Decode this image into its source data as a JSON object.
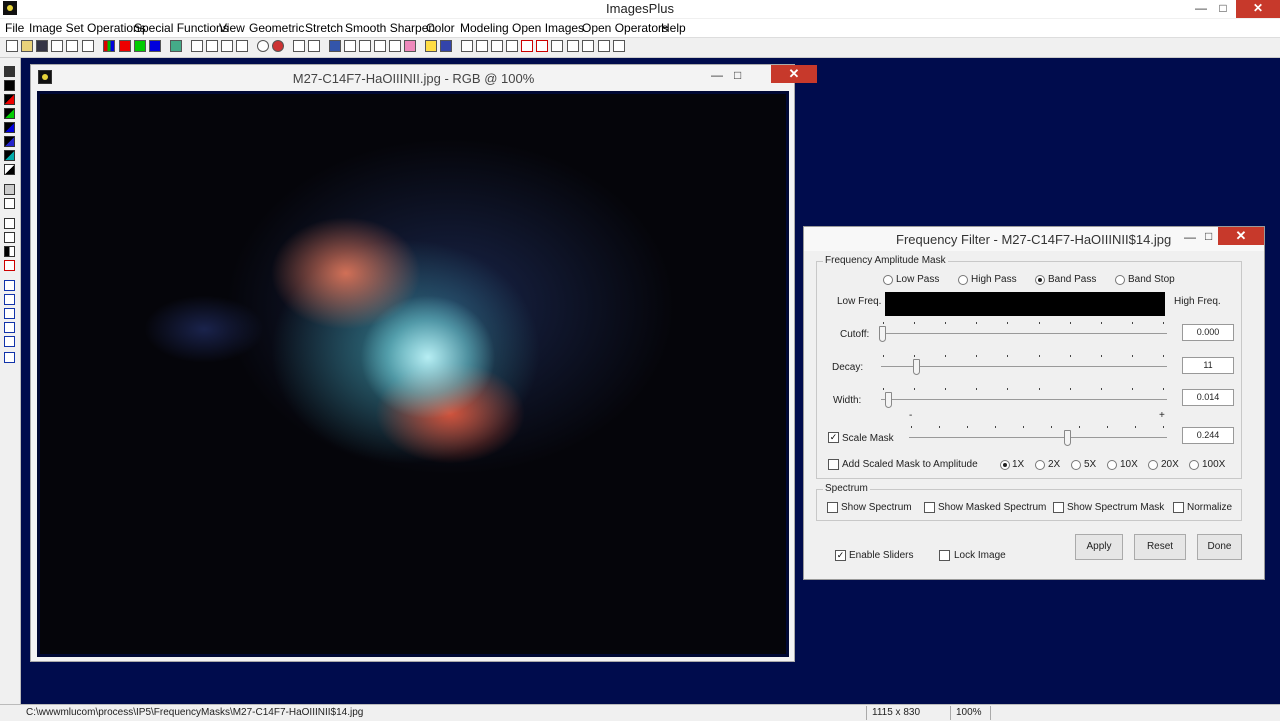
{
  "app": {
    "title": "ImagesPlus",
    "icon": "app-icon"
  },
  "menu": [
    "File",
    "Image Set Operations",
    "Special Functions",
    "View",
    "Geometric",
    "Stretch",
    "Smooth Sharpen",
    "Color",
    "Modeling",
    "Open Images",
    "Open Operators",
    "Help"
  ],
  "image_window": {
    "title": "M27-C14F7-HaOIIINII.jpg - RGB @ 100%"
  },
  "dialog": {
    "title": "Frequency Filter - M27-C14F7-HaOIIINII$14.jpg",
    "mask_group": "Frequency Amplitude Mask",
    "filter_types": [
      "Low Pass",
      "High Pass",
      "Band Pass",
      "Band Stop"
    ],
    "selected_filter": "Band Pass",
    "low_freq_label": "Low Freq.",
    "high_freq_label": "High Freq.",
    "cutoff": {
      "label": "Cutoff:",
      "value": "0.000",
      "level": 0.0
    },
    "decay": {
      "label": "Decay:",
      "value": "11",
      "level": 0.12
    },
    "width": {
      "label": "Width:",
      "value": "0.014",
      "level": 0.02
    },
    "scale_mask": {
      "label": "Scale Mask",
      "checked": true,
      "value": "0.244",
      "level": 0.62,
      "min_mark": "-",
      "max_mark": "+"
    },
    "add_scaled": {
      "label": "Add Scaled Mask to Amplitude",
      "checked": false
    },
    "multipliers": [
      "1X",
      "2X",
      "5X",
      "10X",
      "20X",
      "100X"
    ],
    "selected_multiplier": "1X",
    "spectrum_group": "Spectrum",
    "spectrum_options": [
      "Show Spectrum",
      "Show Masked Spectrum",
      "Show Spectrum Mask",
      "Normalize"
    ],
    "enable_sliders": {
      "label": "Enable Sliders",
      "checked": true
    },
    "lock_image": {
      "label": "Lock Image",
      "checked": false
    },
    "buttons": {
      "apply": "Apply",
      "reset": "Reset",
      "done": "Done"
    }
  },
  "status": {
    "path": "C:\\wwwmlucom\\process\\IP5\\FrequencyMasks\\M27-C14F7-HaOIIINII$14.jpg",
    "dimensions": "1115 x 830",
    "zoom": "100%"
  },
  "colors": {
    "workspace": "#000c4d",
    "close": "#c7392b"
  }
}
